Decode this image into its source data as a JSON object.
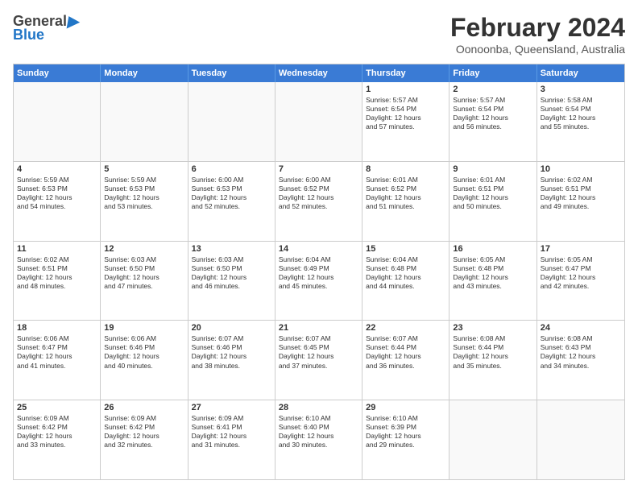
{
  "logo": {
    "general": "General",
    "blue": "Blue"
  },
  "header": {
    "month": "February 2024",
    "location": "Oonoonba, Queensland, Australia"
  },
  "days_of_week": [
    "Sunday",
    "Monday",
    "Tuesday",
    "Wednesday",
    "Thursday",
    "Friday",
    "Saturday"
  ],
  "weeks": [
    [
      {
        "day": "",
        "info": ""
      },
      {
        "day": "",
        "info": ""
      },
      {
        "day": "",
        "info": ""
      },
      {
        "day": "",
        "info": ""
      },
      {
        "day": "1",
        "info": "Sunrise: 5:57 AM\nSunset: 6:54 PM\nDaylight: 12 hours\nand 57 minutes."
      },
      {
        "day": "2",
        "info": "Sunrise: 5:57 AM\nSunset: 6:54 PM\nDaylight: 12 hours\nand 56 minutes."
      },
      {
        "day": "3",
        "info": "Sunrise: 5:58 AM\nSunset: 6:54 PM\nDaylight: 12 hours\nand 55 minutes."
      }
    ],
    [
      {
        "day": "4",
        "info": "Sunrise: 5:59 AM\nSunset: 6:53 PM\nDaylight: 12 hours\nand 54 minutes."
      },
      {
        "day": "5",
        "info": "Sunrise: 5:59 AM\nSunset: 6:53 PM\nDaylight: 12 hours\nand 53 minutes."
      },
      {
        "day": "6",
        "info": "Sunrise: 6:00 AM\nSunset: 6:53 PM\nDaylight: 12 hours\nand 52 minutes."
      },
      {
        "day": "7",
        "info": "Sunrise: 6:00 AM\nSunset: 6:52 PM\nDaylight: 12 hours\nand 52 minutes."
      },
      {
        "day": "8",
        "info": "Sunrise: 6:01 AM\nSunset: 6:52 PM\nDaylight: 12 hours\nand 51 minutes."
      },
      {
        "day": "9",
        "info": "Sunrise: 6:01 AM\nSunset: 6:51 PM\nDaylight: 12 hours\nand 50 minutes."
      },
      {
        "day": "10",
        "info": "Sunrise: 6:02 AM\nSunset: 6:51 PM\nDaylight: 12 hours\nand 49 minutes."
      }
    ],
    [
      {
        "day": "11",
        "info": "Sunrise: 6:02 AM\nSunset: 6:51 PM\nDaylight: 12 hours\nand 48 minutes."
      },
      {
        "day": "12",
        "info": "Sunrise: 6:03 AM\nSunset: 6:50 PM\nDaylight: 12 hours\nand 47 minutes."
      },
      {
        "day": "13",
        "info": "Sunrise: 6:03 AM\nSunset: 6:50 PM\nDaylight: 12 hours\nand 46 minutes."
      },
      {
        "day": "14",
        "info": "Sunrise: 6:04 AM\nSunset: 6:49 PM\nDaylight: 12 hours\nand 45 minutes."
      },
      {
        "day": "15",
        "info": "Sunrise: 6:04 AM\nSunset: 6:48 PM\nDaylight: 12 hours\nand 44 minutes."
      },
      {
        "day": "16",
        "info": "Sunrise: 6:05 AM\nSunset: 6:48 PM\nDaylight: 12 hours\nand 43 minutes."
      },
      {
        "day": "17",
        "info": "Sunrise: 6:05 AM\nSunset: 6:47 PM\nDaylight: 12 hours\nand 42 minutes."
      }
    ],
    [
      {
        "day": "18",
        "info": "Sunrise: 6:06 AM\nSunset: 6:47 PM\nDaylight: 12 hours\nand 41 minutes."
      },
      {
        "day": "19",
        "info": "Sunrise: 6:06 AM\nSunset: 6:46 PM\nDaylight: 12 hours\nand 40 minutes."
      },
      {
        "day": "20",
        "info": "Sunrise: 6:07 AM\nSunset: 6:46 PM\nDaylight: 12 hours\nand 38 minutes."
      },
      {
        "day": "21",
        "info": "Sunrise: 6:07 AM\nSunset: 6:45 PM\nDaylight: 12 hours\nand 37 minutes."
      },
      {
        "day": "22",
        "info": "Sunrise: 6:07 AM\nSunset: 6:44 PM\nDaylight: 12 hours\nand 36 minutes."
      },
      {
        "day": "23",
        "info": "Sunrise: 6:08 AM\nSunset: 6:44 PM\nDaylight: 12 hours\nand 35 minutes."
      },
      {
        "day": "24",
        "info": "Sunrise: 6:08 AM\nSunset: 6:43 PM\nDaylight: 12 hours\nand 34 minutes."
      }
    ],
    [
      {
        "day": "25",
        "info": "Sunrise: 6:09 AM\nSunset: 6:42 PM\nDaylight: 12 hours\nand 33 minutes."
      },
      {
        "day": "26",
        "info": "Sunrise: 6:09 AM\nSunset: 6:42 PM\nDaylight: 12 hours\nand 32 minutes."
      },
      {
        "day": "27",
        "info": "Sunrise: 6:09 AM\nSunset: 6:41 PM\nDaylight: 12 hours\nand 31 minutes."
      },
      {
        "day": "28",
        "info": "Sunrise: 6:10 AM\nSunset: 6:40 PM\nDaylight: 12 hours\nand 30 minutes."
      },
      {
        "day": "29",
        "info": "Sunrise: 6:10 AM\nSunset: 6:39 PM\nDaylight: 12 hours\nand 29 minutes."
      },
      {
        "day": "",
        "info": ""
      },
      {
        "day": "",
        "info": ""
      }
    ]
  ]
}
